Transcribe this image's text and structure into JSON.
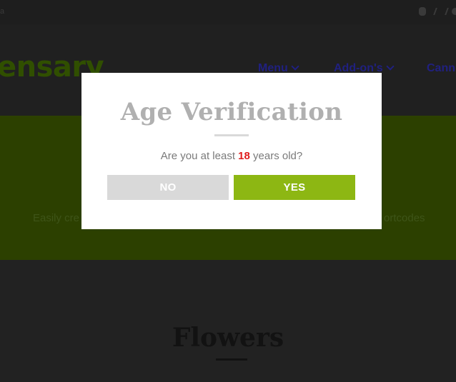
{
  "topbar": {
    "left_glyph": "a",
    "social_icons": [
      "facebook-icon",
      "mastodon-icon",
      "social-icon"
    ]
  },
  "header": {
    "logo_text": "ensary",
    "nav": [
      {
        "label": "Menu",
        "has_dropdown": true
      },
      {
        "label": "Add-on's",
        "has_dropdown": true
      },
      {
        "label": "Cann",
        "has_dropdown": false
      }
    ]
  },
  "hero": {
    "subtitle_left": "Easily cre",
    "subtitle_right": "ortcodes"
  },
  "section": {
    "title": "Flowers"
  },
  "modal": {
    "title": "Age Verification",
    "question_before": "Are you at least ",
    "age": "18",
    "question_after": " years old?",
    "no_label": "NO",
    "yes_label": "YES"
  },
  "colors": {
    "accent_green": "#8db713",
    "age_red": "#e01c1c",
    "no_button": "#d9d9d9",
    "hero_bg_dimmed": "#2c4000"
  }
}
